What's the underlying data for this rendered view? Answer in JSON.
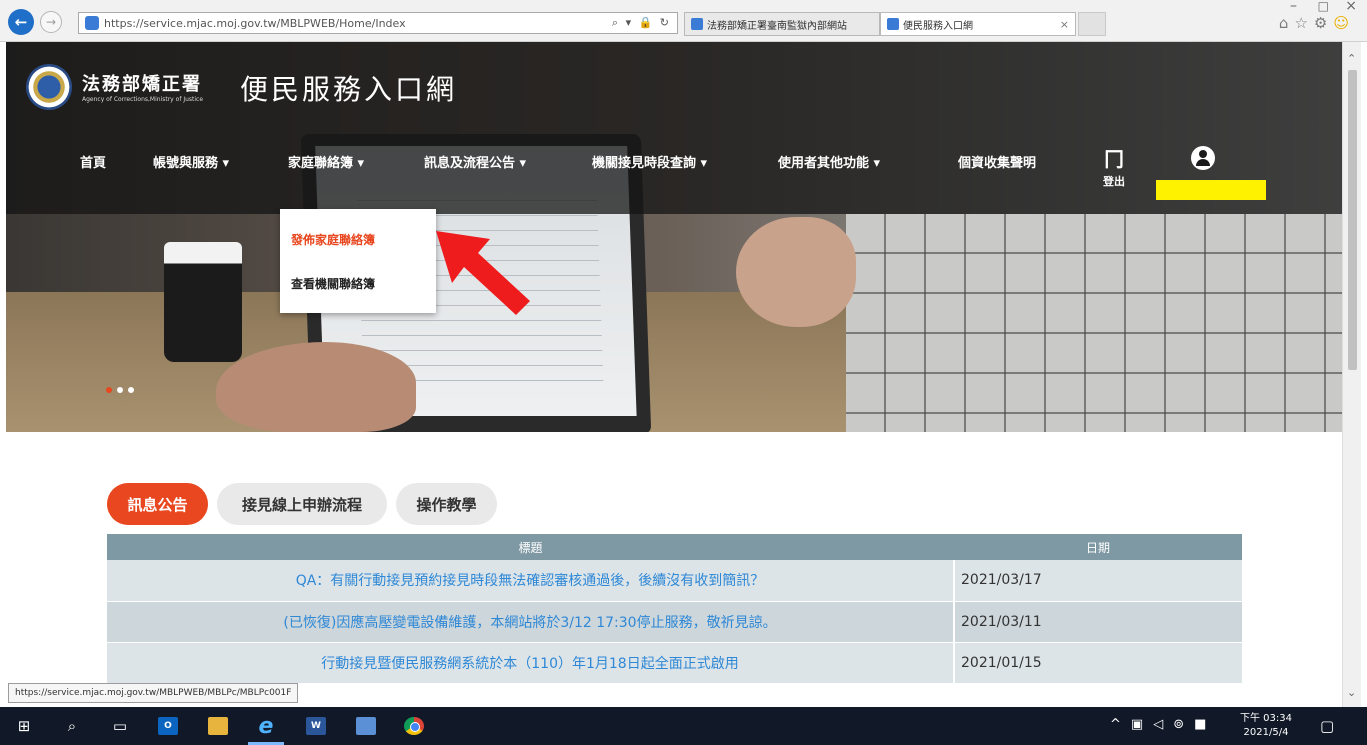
{
  "browser": {
    "url": "https://service.mjac.moj.gov.tw/MBLPWEB/Home/Index",
    "address_tools": "⌕ ▾ 🔒 ↻",
    "tabs": [
      {
        "label": "法務部矯正署臺南監獄內部網站"
      },
      {
        "label": "便民服務入口網"
      }
    ],
    "tab_close": "×",
    "status_url": "https://service.mjac.moj.gov.tw/MBLPWEB/MBLPc/MBLPc001F"
  },
  "site": {
    "org_name": "法務部矯正署",
    "org_subtitle": "Agency of Corrections,Ministry of Justice",
    "portal_title": "便民服務入口網"
  },
  "nav": {
    "home": "首頁",
    "account": "帳號與服務 ▾",
    "family": "家庭聯絡簿 ▾",
    "news": "訊息及流程公告 ▾",
    "visit": "機關接見時段查詢 ▾",
    "user": "使用者其他功能 ▾",
    "privacy": "個資收集聲明",
    "logout": "登出"
  },
  "dropdown": {
    "send": "發佈家庭聯絡簿",
    "view": "查看機關聯絡簿"
  },
  "content_tabs": [
    "訊息公告",
    "接見線上申辦流程",
    "操作教學"
  ],
  "table": {
    "header_title": "標題",
    "header_date": "日期",
    "rows": [
      {
        "title": "QA：有關行動接見預約接見時段無法確認審核通過後，後續沒有收到簡訊？",
        "date": "2021/03/17"
      },
      {
        "title": "(已恢復)因應高壓變電設備維護，本網站將於3/12 17:30停止服務，敬祈見諒。",
        "date": "2021/03/11"
      },
      {
        "title": "行動接見暨便民服務網系統於本（110）年1月18日起全面正式啟用",
        "date": "2021/01/15"
      }
    ]
  },
  "taskbar": {
    "time": "下午 03:34",
    "date": "2021/5/4"
  },
  "colors": {
    "accent": "#e8471f",
    "table_header": "#7f99a4",
    "link": "#2e88d6",
    "highlight": "#fff200"
  }
}
